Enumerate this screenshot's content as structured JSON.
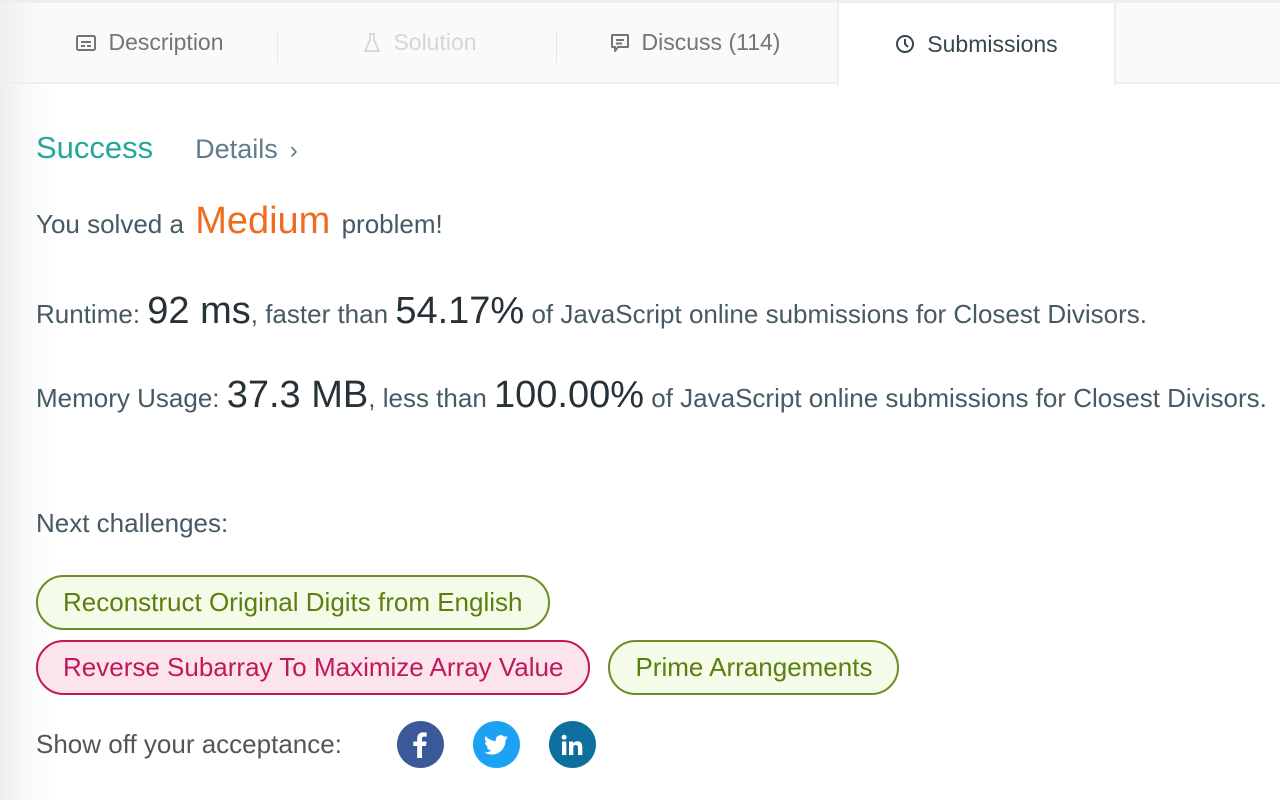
{
  "tabs": [
    {
      "label": "Description",
      "icon": "description-icon",
      "state": "normal"
    },
    {
      "label": "Solution",
      "icon": "flask-icon",
      "state": "disabled"
    },
    {
      "label": "Discuss (114)",
      "icon": "discuss-icon",
      "state": "normal"
    },
    {
      "label": "Submissions",
      "icon": "clock-icon",
      "state": "active"
    }
  ],
  "result": {
    "status": "Success",
    "details_label": "Details",
    "details_chevron": "›",
    "solved_prefix": "You solved a",
    "difficulty": "Medium",
    "solved_suffix": "problem!"
  },
  "runtime": {
    "label": "Runtime:",
    "value": "92 ms",
    "comparison": ", faster than",
    "percent": "54.17%",
    "suffix": "of JavaScript online submissions for Closest Divisors."
  },
  "memory": {
    "label": "Memory Usage:",
    "value": "37.3 MB",
    "comparison": ", less than",
    "percent": "100.00%",
    "suffix": "of JavaScript online submissions for Closest Divisors."
  },
  "next_challenges": {
    "label": "Next challenges:",
    "items": [
      {
        "title": "Reconstruct Original Digits from English",
        "difficulty": "medium"
      },
      {
        "title": "Reverse Subarray To Maximize Array Value",
        "difficulty": "hard"
      },
      {
        "title": "Prime Arrangements",
        "difficulty": "easy"
      }
    ]
  },
  "share": {
    "label": "Show off your acceptance:",
    "networks": [
      {
        "name": "facebook",
        "icon": "facebook-icon",
        "color": "#3b5998"
      },
      {
        "name": "twitter",
        "icon": "twitter-icon",
        "color": "#1da1f2"
      },
      {
        "name": "linkedin",
        "icon": "linkedin-icon",
        "color": "#0e6e9e"
      }
    ]
  }
}
